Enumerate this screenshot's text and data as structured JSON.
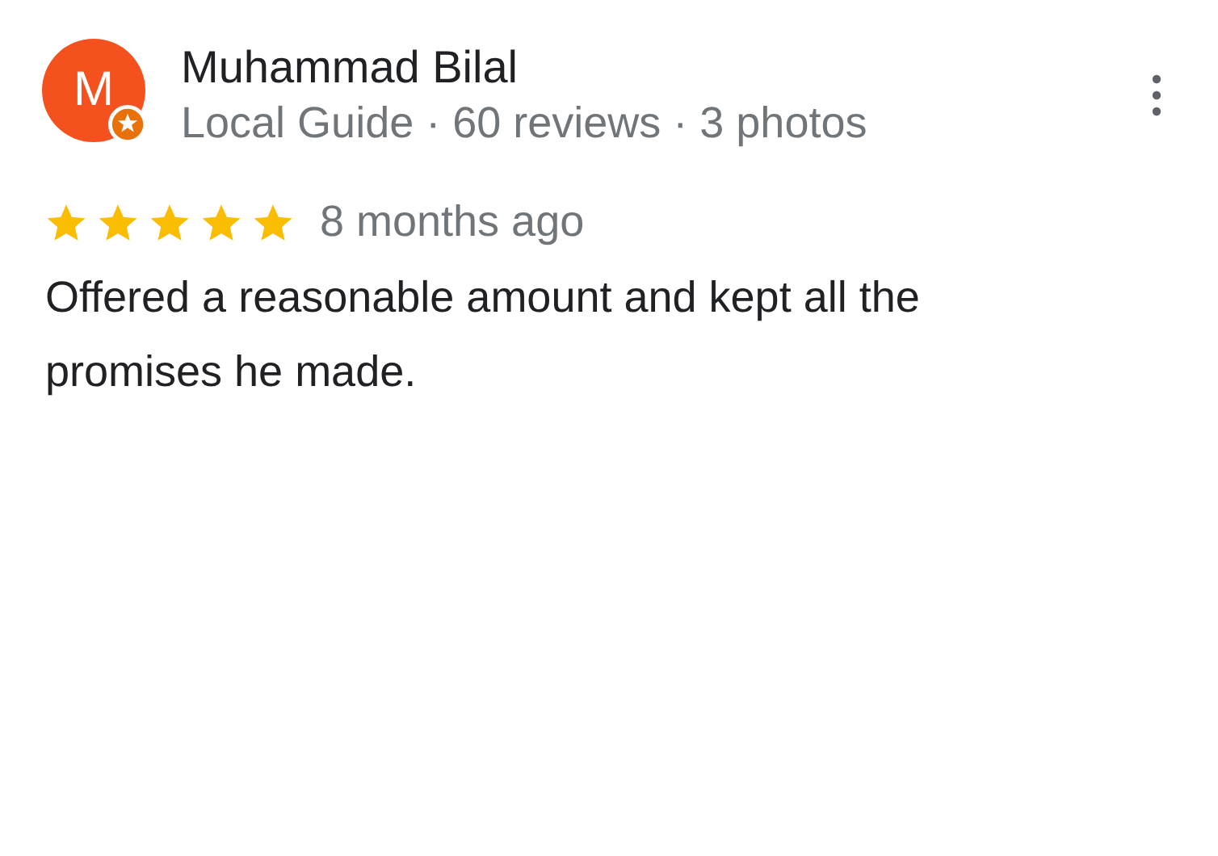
{
  "review": {
    "avatar_letter": "M",
    "local_guide": true,
    "name": "Muhammad Bilal",
    "meta": "Local Guide · 60 reviews · 3 photos",
    "stars": 5,
    "time": "8 months ago",
    "text": "Offered a reasonable amount and kept all the promises he made."
  }
}
